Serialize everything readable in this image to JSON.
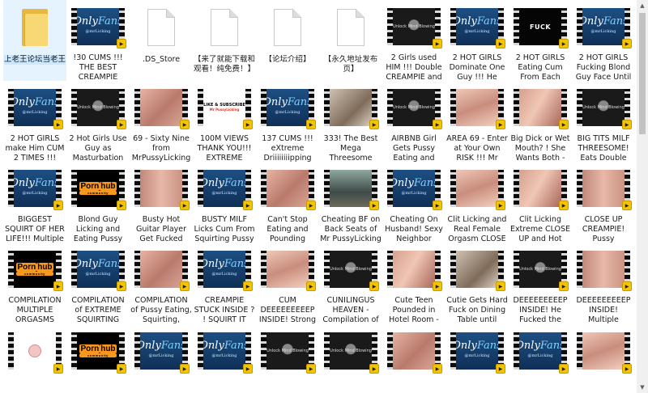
{
  "rows": [
    [
      {
        "kind": "folder",
        "label": "上老王论坛当老王",
        "selected": true
      },
      {
        "kind": "video",
        "thumb": "of",
        "label": "!30 CUMS !!! THE BEST CREAMPIE COMPILATIO..."
      },
      {
        "kind": "doc",
        "label": ".DS_Store"
      },
      {
        "kind": "doc",
        "label": "【来了就能下载和观看！纯免费！】"
      },
      {
        "kind": "doc",
        "label": "【论坛介绍】"
      },
      {
        "kind": "doc",
        "label": "【永久地址发布页】"
      },
      {
        "kind": "video",
        "thumb": "lk",
        "label": "2 Girls used HIM !!! Double CREAMPIE and BIGGEST Sha..."
      },
      {
        "kind": "video",
        "thumb": "of",
        "label": "2 HOT GIRLS Dominate One Guy !!! He CUMS 2 TIME..."
      },
      {
        "kind": "video",
        "thumb": "fk",
        "label": "2 HOT GIRLS Eating Cum From Each Other Pussy!!..."
      },
      {
        "kind": "video",
        "thumb": "of",
        "label": "2 HOT GIRLS Fucking Blond Guy Face Until SHAKING PUS..."
      }
    ],
    [
      {
        "kind": "video",
        "thumb": "of",
        "label": "2 HOT GIRLS make Him CUM 2 TIMES !!! SHAKING SQ..."
      },
      {
        "kind": "video",
        "thumb": "lk",
        "label": "2 Hot Girls Use Guy as Masturbation Surface !!! Do..."
      },
      {
        "kind": "video",
        "thumb": "sk1",
        "label": "69 - Sixty Nine from MrPussyLicking [ph5fd14b03..."
      },
      {
        "kind": "video",
        "thumb": "lt",
        "label": "100M VIEWS THANK YOU!!! EXTREME SQUIRTING ..."
      },
      {
        "kind": "video",
        "thumb": "of",
        "label": "137 CUMS !!! eXtreme Driiiiiiiipping Compilation -..."
      },
      {
        "kind": "video",
        "thumb": "room",
        "label": "333! The Best Mega Threesome Compilation [..."
      },
      {
        "kind": "video",
        "thumb": "lk",
        "label": "AIRBNB Girl Gets Pussy Eating and Fucking while ..."
      },
      {
        "kind": "video",
        "thumb": "sk2",
        "label": "AREA 69 - Enter at Your Own RISK !!! Mr PussyLicking [..."
      },
      {
        "kind": "video",
        "thumb": "sk3",
        "label": "Big Dick or Wet Mouth? ! She Wants Both - MrPussyLickin..."
      },
      {
        "kind": "video",
        "thumb": "lk",
        "label": "BIG TITS MILF THREESOME! Eats Double Cum from Ste..."
      }
    ],
    [
      {
        "kind": "video",
        "thumb": "of",
        "label": "BIGGEST SQUIRT OF HER LIFE!!! Multiple Amat..."
      },
      {
        "kind": "video",
        "thumb": "ph",
        "label": "Blond Guy Licking and Eating Pussy With Passion ..."
      },
      {
        "kind": "video",
        "thumb": "sk4",
        "label": "Busty Hot Guitar Player Get Fucked DEEEEEEEEEP!..."
      },
      {
        "kind": "video",
        "thumb": "of",
        "label": "BUSTY MILF Licks Cum From Squirting Pussy - Threesome [..."
      },
      {
        "kind": "video",
        "thumb": "sk1",
        "label": "Can't Stop Eating and Pounding Perfect Pussy!..."
      },
      {
        "kind": "video",
        "thumb": "car",
        "label": "Cheating BF on Back Seats of Mr PussyLicking ..."
      },
      {
        "kind": "video",
        "thumb": "of",
        "label": "Cheating On Husband! Sexy Neighbor Needs Showe..."
      },
      {
        "kind": "video",
        "thumb": "sk2",
        "label": "Clit Licking and Real Female Orgasm CLOSE UP POV - MrP..."
      },
      {
        "kind": "video",
        "thumb": "sk3",
        "label": "Clit Licking Extreme CLOSE UP and Hot Real Orgasm ..."
      },
      {
        "kind": "video",
        "thumb": "sk4",
        "label": "CLOSE UP CREAMPIE! Pussy Treatment by..."
      }
    ],
    [
      {
        "kind": "video",
        "thumb": "ph",
        "label": "COMPILATION MULTIPLE ORGASMS PUSSY EATIN..."
      },
      {
        "kind": "video",
        "thumb": "of",
        "label": "COMPILATION of EXTREME SQUIRTING ORGASMS - ..."
      },
      {
        "kind": "video",
        "thumb": "sk1",
        "label": "COMPILATION of Pussy Eating, Squirting, Facesitting an..."
      },
      {
        "kind": "video",
        "thumb": "of",
        "label": "CREAMPIE STUCK INSIDE ? ! SQUIRT IT OUT!!! Pussy ..."
      },
      {
        "kind": "video",
        "thumb": "sk2",
        "label": "CUM DEEEEEEEEEP INSIDE! Strong Shaking Orga..."
      },
      {
        "kind": "video",
        "thumb": "lk",
        "label": "CUNILINGUS HEAVEN - Compilation of the Best Orga..."
      },
      {
        "kind": "video",
        "thumb": "sk3",
        "label": "Cute Teen Pounded in Hotel Room - INCREDIBLE ..."
      },
      {
        "kind": "video",
        "thumb": "room",
        "label": "Cutie Gets Hard Fuck on Dining Table until Insane Shakin..."
      },
      {
        "kind": "video",
        "thumb": "lk",
        "label": "DEEEEEEEEEP INSIDE! He Fucked the Squirt out of ..."
      },
      {
        "kind": "video",
        "thumb": "sk4",
        "label": "DEEEEEEEEEP INSIDE! Multiple Creampie to P..."
      }
    ],
    [
      {
        "kind": "video",
        "thumb": "circ",
        "label": ""
      },
      {
        "kind": "video",
        "thumb": "ph",
        "label": ""
      },
      {
        "kind": "video",
        "thumb": "of",
        "label": ""
      },
      {
        "kind": "video",
        "thumb": "of",
        "label": ""
      },
      {
        "kind": "video",
        "thumb": "lk",
        "label": ""
      },
      {
        "kind": "video",
        "thumb": "lk",
        "label": ""
      },
      {
        "kind": "video",
        "thumb": "sk1",
        "label": ""
      },
      {
        "kind": "video",
        "thumb": "of",
        "label": ""
      },
      {
        "kind": "video",
        "thumb": "of",
        "label": ""
      },
      {
        "kind": "video",
        "thumb": "sk2",
        "label": ""
      }
    ]
  ],
  "thumb_text": {
    "of": {
      "main": "Only",
      "accent": "Fans",
      "sub": "@mrLicking"
    },
    "lk": {
      "main": "Unlock Mind Blowing"
    },
    "fk": {
      "main": "FUCK"
    },
    "ph": {
      "main": "Porn",
      "accent": "hub",
      "sub": "community"
    },
    "lt": {
      "main": "LIKE & SUBSCRIBE",
      "sub": "Mr PussyLicking"
    }
  },
  "icons": {
    "folder": "folder-icon",
    "doc": "document-icon",
    "video": "video-file-icon",
    "badge": "player-badge-icon"
  },
  "scrollbar": {
    "up": "▲",
    "down": "▼"
  }
}
